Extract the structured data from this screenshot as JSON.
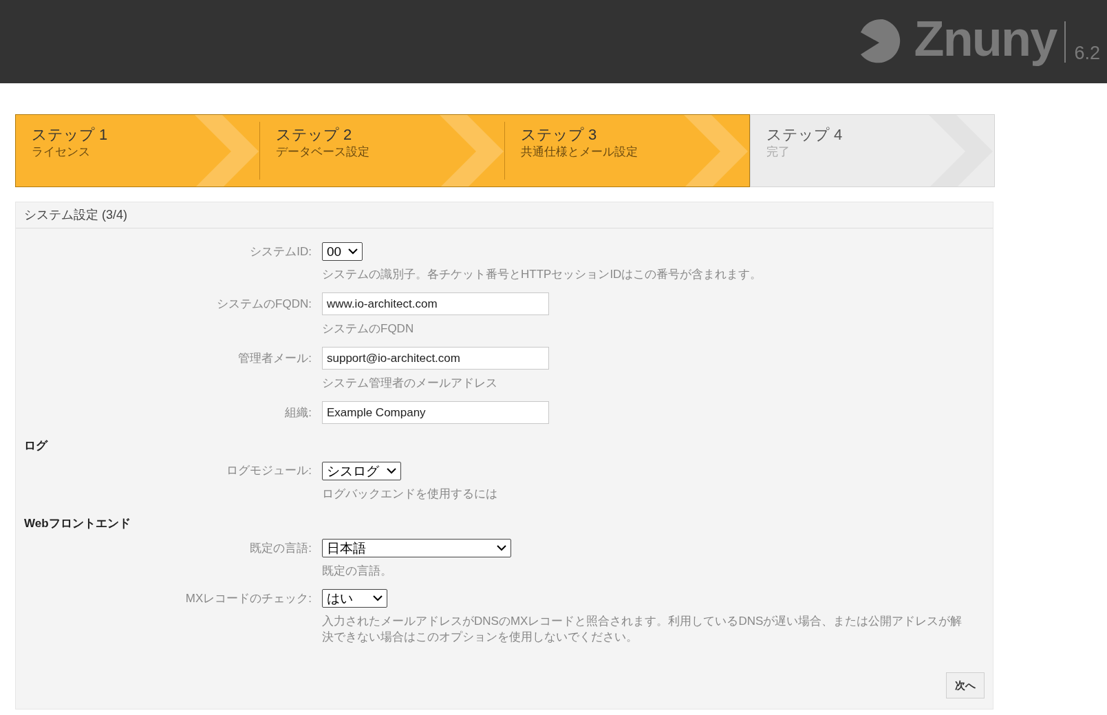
{
  "header": {
    "logo": {
      "name": "Znuny",
      "version": "6.2"
    }
  },
  "steps": [
    {
      "title": "ステップ 1",
      "subtitle": "ライセンス",
      "done": true
    },
    {
      "title": "ステップ 2",
      "subtitle": "データベース設定",
      "done": true
    },
    {
      "title": "ステップ 3",
      "subtitle": "共通仕様とメール設定",
      "done": true
    },
    {
      "title": "ステップ 4",
      "subtitle": "完了",
      "done": false
    }
  ],
  "panel": {
    "title": "システム設定 (3/4)",
    "fields": [
      {
        "kind": "select",
        "label": "システムID:",
        "value": "00",
        "hint": "システムの識別子。各チケット番号とHTTPセッションIDはこの番号が含まれます。"
      },
      {
        "kind": "input",
        "label": "システムのFQDN:",
        "value": "www.io-architect.com",
        "hint": "システムのFQDN"
      },
      {
        "kind": "input",
        "label": "管理者メール:",
        "value": "support@io-architect.com",
        "hint": "システム管理者のメールアドレス"
      },
      {
        "kind": "input",
        "label": "組織:",
        "value": "Example Company"
      },
      {
        "kind": "heading",
        "label": "ログ"
      },
      {
        "kind": "select",
        "label": "ログモジュール:",
        "value": "シスログ",
        "hint": "ログバックエンドを使用するには"
      },
      {
        "kind": "heading",
        "label": "Webフロントエンド"
      },
      {
        "kind": "select",
        "label": "既定の言語:",
        "value": "日本語",
        "hint": "既定の言語。"
      },
      {
        "kind": "select",
        "label": "MXレコードのチェック:",
        "value": "はい",
        "hint": "入力されたメールアドレスがDNSのMXレコードと照合されます。利用しているDNSが遅い場合、または公開アドレスが解決できない場合はこのオプションを使用しないでください。"
      }
    ],
    "next_button": "次へ"
  }
}
